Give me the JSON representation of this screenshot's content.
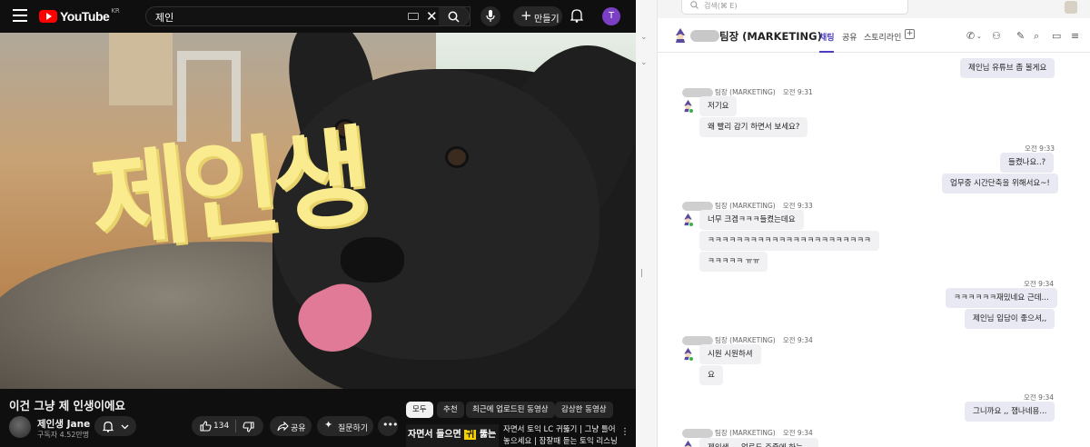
{
  "youtube": {
    "logo_text": "YouTube",
    "logo_region": "KR",
    "search_query": "제인",
    "create_label": "만들기",
    "avatar_letter": "T",
    "video_overlay_text": "제인생",
    "video_title": "이건 그냥 제 인생이에요",
    "channel_name": "제인생 Jane",
    "channel_subscribers": "구독자 4.52만명",
    "like_count": "134",
    "share_label": "공유",
    "ask_label": "질문하기",
    "filters": [
      "모두",
      "추천",
      "최근에 업로드된 동영상",
      "감상한 동영상"
    ],
    "recommended": {
      "thumb_text_a": "자면서 들으면",
      "thumb_text_b": "귀",
      "thumb_text_c": "뚫는",
      "title": "자면서 토익 LC 귀뚫기 | 그냥 틀어 놓으세요 | 잠잘때 듣는 토익 리스닝 ..."
    }
  },
  "chat": {
    "search_placeholder": "검색(⌘ E)",
    "room_title": "팀장 (MARKETING)",
    "tabs": [
      "채팅",
      "공유",
      "스토리라인"
    ],
    "colors": {
      "accent": "#4b3fbf",
      "online": "#34b24a"
    },
    "messages": {
      "m1": "제인님 유튜브 좀 볼게요",
      "s1_name": "팀장 (MARKETING)",
      "s1_time": "오전 9:31",
      "m2": "저기요",
      "m3": "왜 빨리 감기 하면서 보세요?",
      "t1": "오전 9:33",
      "m4": "들켰나요..?",
      "m5": "업무중 시간단축을 위해서요~!",
      "s2_name": "팀장 (MARKETING)",
      "s2_time": "오전 9:33",
      "m6": "너무 크겜ㅋㅋㅋ들켰는데요",
      "m7": "ㅋㅋㅋㅋㅋㅋㅋㅋㅋㅋㅋㅋㅋㅋㅋㅋㅋㅋㅋㅋㅋㅋㅋ",
      "m8": "ㅋㅋㅋㅋㅋ ㅠㅠ",
      "t2": "오전 9:34",
      "m9": "ㅋㅋㅋㅋㅋㅋ재밌네요 근데...",
      "m10": "제인님 입담이 좋으셔,,",
      "s3_name": "팀장 (MARKETING)",
      "s3_time": "오전 9:34",
      "m11": "시원 시원하셔",
      "m12": "요",
      "t3": "오전 9:34",
      "m13": "그니까요 ,, 잼나네용...",
      "s4_name": "팀장 (MARKETING)",
      "s4_time": "오전 9:34",
      "m14": "제인생 ... 업로드 주중에 하는..."
    }
  }
}
